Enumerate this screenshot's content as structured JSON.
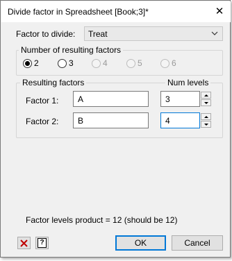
{
  "window": {
    "title": "Divide factor in Spreadsheet [Book;3]*"
  },
  "factor_to_divide": {
    "label": "Factor to divide:",
    "value": "Treat"
  },
  "number_group": {
    "title": "Number of resulting factors",
    "options": [
      {
        "label": "2",
        "checked": true,
        "enabled": true
      },
      {
        "label": "3",
        "checked": false,
        "enabled": true
      },
      {
        "label": "4",
        "checked": false,
        "enabled": false
      },
      {
        "label": "5",
        "checked": false,
        "enabled": false
      },
      {
        "label": "6",
        "checked": false,
        "enabled": false
      }
    ]
  },
  "resulting_group": {
    "title": "Resulting factors",
    "num_levels_header": "Num levels",
    "factors": [
      {
        "label": "Factor 1:",
        "name": "A",
        "levels": "3"
      },
      {
        "label": "Factor 2:",
        "name": "B",
        "levels": "4"
      }
    ]
  },
  "status_text": "Factor levels product = 12 (should be 12)",
  "buttons": {
    "ok": "OK",
    "cancel": "Cancel"
  },
  "icons": {
    "close": "close-icon",
    "clear": "clear-x-icon",
    "help": "help-icon"
  },
  "colors": {
    "focus_border": "#0078d7",
    "clear_icon": "#c00000",
    "background": "#f0f0f0"
  }
}
